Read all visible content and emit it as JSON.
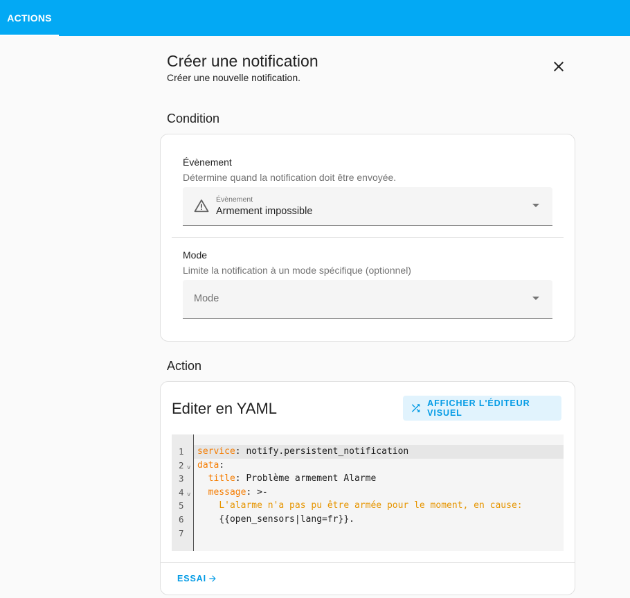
{
  "topbar": {
    "tab_label": "ACTIONS",
    "color": "#03a9f4"
  },
  "dialog": {
    "title": "Créer une notification",
    "subtitle": "Créer une nouvelle notification.",
    "close_icon": "close-icon"
  },
  "condition": {
    "section_title": "Condition",
    "event": {
      "label": "Évènement",
      "description": "Détermine quand la notification doit être envoyée.",
      "select_label": "Évènement",
      "value": "Armement impossible",
      "icon": "warning-icon"
    },
    "mode": {
      "label": "Mode",
      "description": "Limite la notification à un mode spécifique (optionnel)",
      "placeholder": "Mode"
    }
  },
  "action": {
    "section_title": "Action",
    "editor_title": "Editer en YAML",
    "visual_editor_button": "AFFICHER L'ÉDITEUR VISUEL",
    "yaml_lines": [
      {
        "n": "1",
        "key": "service",
        "sep": ": ",
        "val": "notify.persistent_notification",
        "indent": ""
      },
      {
        "n": "2",
        "key": "data",
        "sep": ":",
        "val": "",
        "indent": ""
      },
      {
        "n": "3",
        "key": "title",
        "sep": ": ",
        "val": "Problème armement Alarme",
        "indent": "  "
      },
      {
        "n": "4",
        "key": "message",
        "sep": ": ",
        "val": ">-",
        "indent": "  "
      },
      {
        "n": "5",
        "str": "L'alarme n'a pas pu être armée pour le moment, en cause:",
        "indent": "    "
      },
      {
        "n": "6",
        "plain": "{{open_sensors|lang=fr}}.",
        "indent": "    "
      },
      {
        "n": "7",
        "plain": "",
        "indent": ""
      }
    ],
    "run_button": "ESSAI",
    "accent_color": "#039be5"
  }
}
